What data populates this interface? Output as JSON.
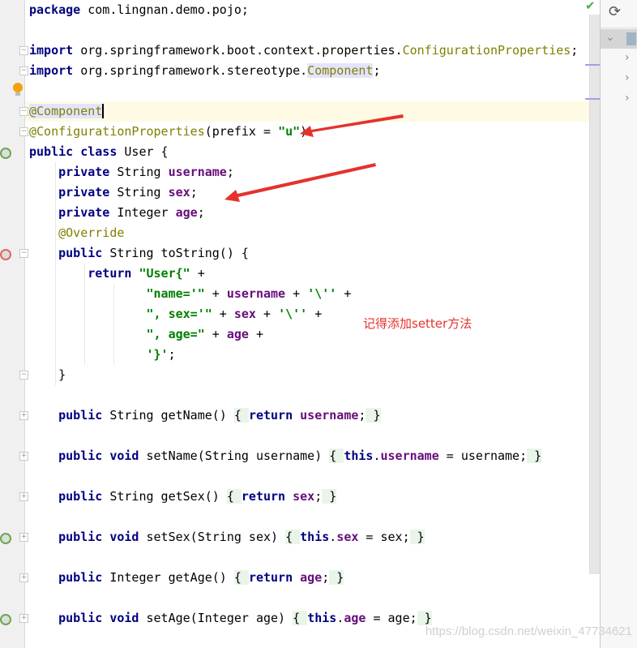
{
  "editor": {
    "lines": [
      {
        "tokens": [
          {
            "t": "package",
            "c": "kw"
          },
          {
            "t": " com.lingnan.demo.pojo;"
          }
        ]
      },
      {
        "tokens": []
      },
      {
        "tokens": [
          {
            "t": "import",
            "c": "kw"
          },
          {
            "t": " org.springframework.boot.context.properties."
          },
          {
            "t": "ConfigurationProperties",
            "c": "ann"
          },
          {
            "t": ";"
          }
        ]
      },
      {
        "tokens": [
          {
            "t": "import",
            "c": "kw"
          },
          {
            "t": " org.springframework.stereotype."
          },
          {
            "t": "Component",
            "c": "ann hl"
          },
          {
            "t": ";"
          }
        ]
      },
      {
        "tokens": []
      },
      {
        "tokens": [
          {
            "t": "@Component",
            "c": "ann hl caret"
          }
        ],
        "current": true
      },
      {
        "tokens": [
          {
            "t": "@ConfigurationProperties",
            "c": "ann"
          },
          {
            "t": "(prefix = "
          },
          {
            "t": "\"u\"",
            "c": "str"
          },
          {
            "t": ")"
          }
        ]
      },
      {
        "tokens": [
          {
            "t": "public class",
            "c": "kw"
          },
          {
            "t": " User {"
          }
        ]
      },
      {
        "tokens": [
          {
            "t": "    "
          },
          {
            "t": "private",
            "c": "kw"
          },
          {
            "t": " String "
          },
          {
            "t": "username",
            "c": "fld"
          },
          {
            "t": ";"
          }
        ]
      },
      {
        "tokens": [
          {
            "t": "    "
          },
          {
            "t": "private",
            "c": "kw"
          },
          {
            "t": " String "
          },
          {
            "t": "sex",
            "c": "fld"
          },
          {
            "t": ";"
          }
        ]
      },
      {
        "tokens": [
          {
            "t": "    "
          },
          {
            "t": "private",
            "c": "kw"
          },
          {
            "t": " Integer "
          },
          {
            "t": "age",
            "c": "fld"
          },
          {
            "t": ";"
          }
        ]
      },
      {
        "tokens": [
          {
            "t": "    "
          },
          {
            "t": "@Override",
            "c": "ann"
          }
        ]
      },
      {
        "tokens": [
          {
            "t": "    "
          },
          {
            "t": "public",
            "c": "kw"
          },
          {
            "t": " String toString() {"
          }
        ]
      },
      {
        "tokens": [
          {
            "t": "        "
          },
          {
            "t": "return",
            "c": "kw"
          },
          {
            "t": " "
          },
          {
            "t": "\"User{\"",
            "c": "str"
          },
          {
            "t": " +"
          }
        ]
      },
      {
        "tokens": [
          {
            "t": "                "
          },
          {
            "t": "\"name='\"",
            "c": "str"
          },
          {
            "t": " + "
          },
          {
            "t": "username",
            "c": "fld"
          },
          {
            "t": " + "
          },
          {
            "t": "'\\''",
            "c": "str"
          },
          {
            "t": " +"
          }
        ]
      },
      {
        "tokens": [
          {
            "t": "                "
          },
          {
            "t": "\", sex='\"",
            "c": "str"
          },
          {
            "t": " + "
          },
          {
            "t": "sex",
            "c": "fld"
          },
          {
            "t": " + "
          },
          {
            "t": "'\\''",
            "c": "str"
          },
          {
            "t": " +"
          }
        ]
      },
      {
        "tokens": [
          {
            "t": "                "
          },
          {
            "t": "\", age=\"",
            "c": "str"
          },
          {
            "t": " + "
          },
          {
            "t": "age",
            "c": "fld"
          },
          {
            "t": " +"
          }
        ]
      },
      {
        "tokens": [
          {
            "t": "                "
          },
          {
            "t": "'}'",
            "c": "str"
          },
          {
            "t": ";"
          }
        ]
      },
      {
        "tokens": [
          {
            "t": "    }"
          }
        ]
      },
      {
        "tokens": []
      },
      {
        "tokens": [
          {
            "t": "    "
          },
          {
            "t": "public",
            "c": "kw"
          },
          {
            "t": " String getName() "
          },
          {
            "t": "{ ",
            "c": "fold"
          },
          {
            "t": "return",
            "c": "kw"
          },
          {
            "t": " "
          },
          {
            "t": "username",
            "c": "fld"
          },
          {
            "t": ";"
          },
          {
            "t": " }",
            "c": "fold"
          }
        ]
      },
      {
        "tokens": []
      },
      {
        "tokens": [
          {
            "t": "    "
          },
          {
            "t": "public void",
            "c": "kw"
          },
          {
            "t": " setName(String username) "
          },
          {
            "t": "{ ",
            "c": "fold"
          },
          {
            "t": "this",
            "c": "kw"
          },
          {
            "t": "."
          },
          {
            "t": "username",
            "c": "fld"
          },
          {
            "t": " = username;"
          },
          {
            "t": " }",
            "c": "fold"
          }
        ]
      },
      {
        "tokens": []
      },
      {
        "tokens": [
          {
            "t": "    "
          },
          {
            "t": "public",
            "c": "kw"
          },
          {
            "t": " String getSex() "
          },
          {
            "t": "{ ",
            "c": "fold"
          },
          {
            "t": "return",
            "c": "kw"
          },
          {
            "t": " "
          },
          {
            "t": "sex",
            "c": "fld"
          },
          {
            "t": ";"
          },
          {
            "t": " }",
            "c": "fold"
          }
        ]
      },
      {
        "tokens": []
      },
      {
        "tokens": [
          {
            "t": "    "
          },
          {
            "t": "public void",
            "c": "kw"
          },
          {
            "t": " setSex(String sex) "
          },
          {
            "t": "{ ",
            "c": "fold"
          },
          {
            "t": "this",
            "c": "kw"
          },
          {
            "t": "."
          },
          {
            "t": "sex",
            "c": "fld"
          },
          {
            "t": " = sex;"
          },
          {
            "t": " }",
            "c": "fold"
          }
        ]
      },
      {
        "tokens": []
      },
      {
        "tokens": [
          {
            "t": "    "
          },
          {
            "t": "public",
            "c": "kw"
          },
          {
            "t": " Integer getAge() "
          },
          {
            "t": "{ ",
            "c": "fold"
          },
          {
            "t": "return",
            "c": "kw"
          },
          {
            "t": " "
          },
          {
            "t": "age",
            "c": "fld"
          },
          {
            "t": ";"
          },
          {
            "t": " }",
            "c": "fold"
          }
        ]
      },
      {
        "tokens": []
      },
      {
        "tokens": [
          {
            "t": "    "
          },
          {
            "t": "public void",
            "c": "kw"
          },
          {
            "t": " setAge(Integer age) "
          },
          {
            "t": "{ ",
            "c": "fold"
          },
          {
            "t": "this",
            "c": "kw"
          },
          {
            "t": "."
          },
          {
            "t": "age",
            "c": "fld"
          },
          {
            "t": " = age;"
          },
          {
            "t": " }",
            "c": "fold"
          }
        ]
      }
    ]
  },
  "annotation": {
    "note": "记得添加setter方法",
    "arrow_color": "#e5322d"
  },
  "watermark": "https://blog.csdn.net/weixin_47734621",
  "icons": {
    "inspection_status": "check-icon",
    "refresh": "refresh-icon",
    "intention": "lightbulb-icon"
  },
  "colors": {
    "keyword": "#000080",
    "annotation": "#808000",
    "string": "#008000",
    "field": "#660e7a",
    "current_line": "#fffae3"
  }
}
